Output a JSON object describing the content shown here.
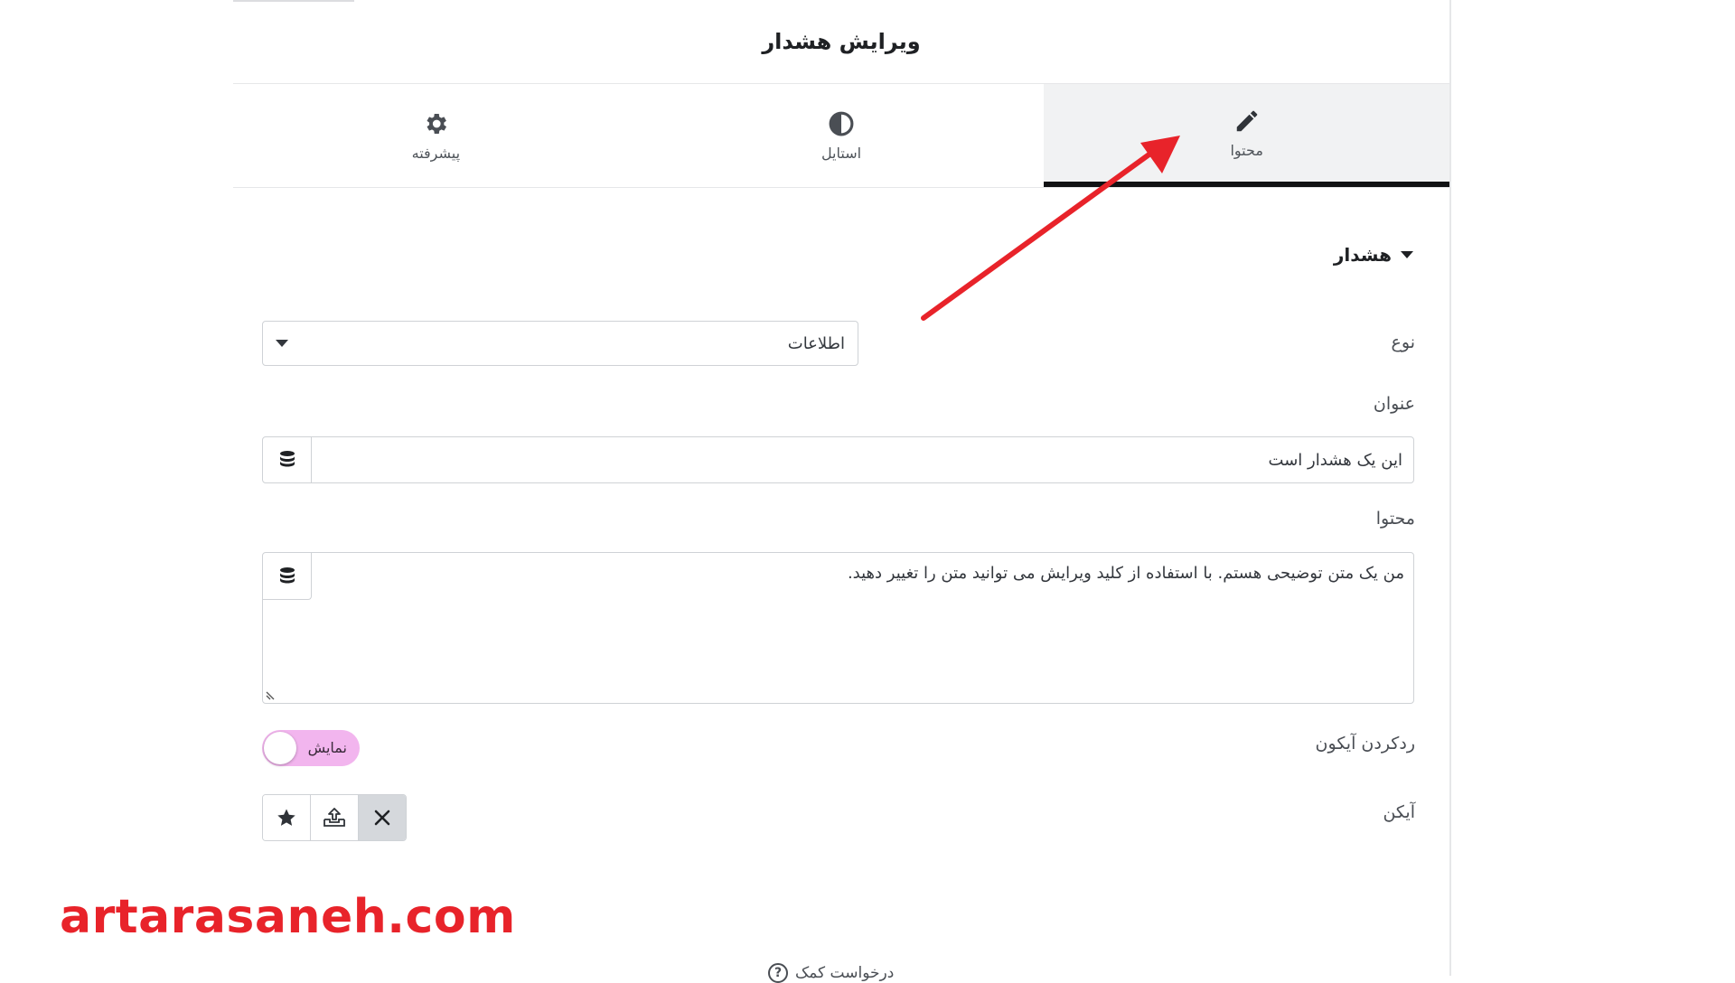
{
  "panel": {
    "title": "ویرایش هشدار"
  },
  "tabs": [
    {
      "label": "محتوا",
      "icon": "pencil-icon",
      "active": true
    },
    {
      "label": "استایل",
      "icon": "contrast-icon",
      "active": false
    },
    {
      "label": "پیشرفته",
      "icon": "gear-icon",
      "active": false
    }
  ],
  "section": {
    "title": "هشدار"
  },
  "fields": {
    "type": {
      "label": "نوع",
      "value": "اطلاعات"
    },
    "title": {
      "label": "عنوان",
      "value": "این یک هشدار است",
      "icon": "database-icon"
    },
    "content": {
      "label": "محتوا",
      "value": "من یک متن توضیحی هستم. با استفاده از کلید ویرایش می توانید متن را تغییر دهید.",
      "icon": "database-icon"
    },
    "dismiss_icon": {
      "label": "ردکردن آیکون",
      "toggle_text": "نمایش"
    },
    "icon": {
      "label": "آیکن",
      "buttons": [
        "star-icon",
        "upload-icon",
        "close-icon"
      ]
    }
  },
  "footer": {
    "help": "درخواست کمک",
    "help_icon": "?"
  },
  "watermark": "artarasaneh.com",
  "colors": {
    "arrow": "#e8232a",
    "toggle": "#f2b5ee",
    "active_tab_bar": "#111214"
  }
}
